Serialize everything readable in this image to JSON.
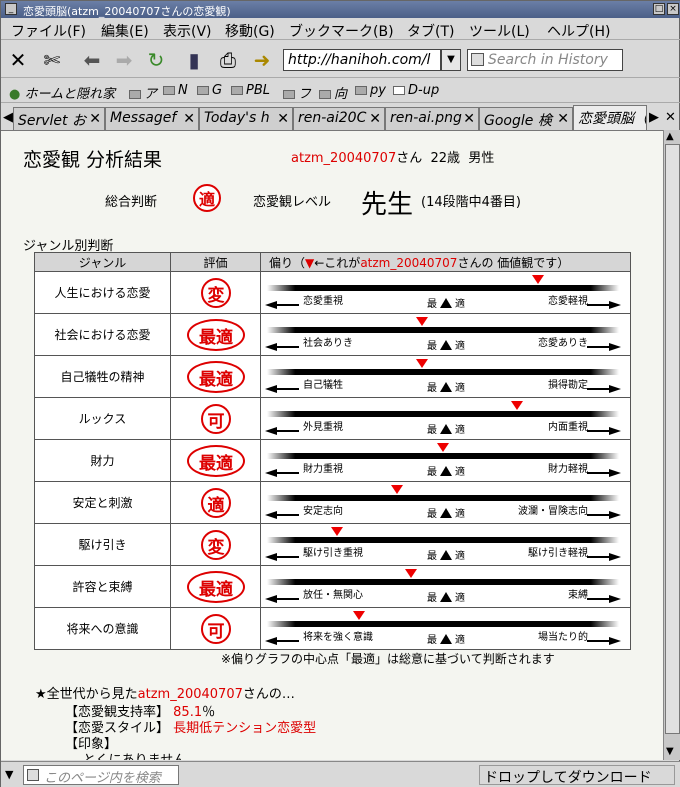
{
  "window": {
    "title": "恋愛頭脳(atzm_20040707さんの恋愛観)"
  },
  "menu": [
    "ファイル(F)",
    "編集(E)",
    "表示(V)",
    "移動(G)",
    "ブックマーク(B)",
    "タブ(T)",
    "ツール(L)",
    "ヘルプ(H)"
  ],
  "toolbar": {
    "url": "http://hanihoh.com/l",
    "search_placeholder": "Search in History"
  },
  "bookmarks": [
    "ホームと隠れ家",
    "ア",
    "N",
    "G",
    "PBL",
    "フ",
    "向",
    "py",
    "D-up"
  ],
  "tabs": [
    "Servlet お",
    "Messagef",
    "Today's h",
    "ren-ai20C",
    "ren-ai.png",
    "Google 検",
    "恋愛頭脳（"
  ],
  "page": {
    "title": "恋愛観 分析結果",
    "user": "atzm_20040707",
    "user_suffix": "さん",
    "age": "22歳",
    "sex": "男性",
    "overall_label": "総合判断",
    "overall_stamp": "適",
    "level_label": "恋愛観レベル",
    "level_value": "先生",
    "level_note": "(14段階中4番目)",
    "genre_heading": "ジャンル別判断",
    "col_genre": "ジャンル",
    "col_eval": "評価",
    "col_bias_a": "偏り（",
    "col_bias_b": "←これが",
    "col_bias_c": "さんの 価値観です）",
    "mid_label": "最",
    "mid_label2": "適",
    "note": "※偏りグラフの中心点「最適」は総意に基づいて判断されます",
    "all_gen": "★全世代から見た",
    "all_gen_suffix": "さんの…",
    "support_label": "【恋愛観支持率】",
    "support_value": "85.1",
    "support_unit": "％",
    "style_label": "【恋愛スタイル】",
    "style_value": "長期低テンション恋愛型",
    "impression_label": "【印象】",
    "impression_value": "とくにありません"
  },
  "rows": [
    {
      "genre": "人生における恋愛",
      "eval": "変",
      "left": "恋愛重視",
      "right": "恋愛軽視",
      "pos": 0.77
    },
    {
      "genre": "社会における恋愛",
      "eval": "最適",
      "left": "社会ありき",
      "right": "恋愛ありき",
      "pos": 0.44
    },
    {
      "genre": "自己犠牲の精神",
      "eval": "最適",
      "left": "自己犠牲",
      "right": "損得勘定",
      "pos": 0.44
    },
    {
      "genre": "ルックス",
      "eval": "可",
      "left": "外見重視",
      "right": "内面重視",
      "pos": 0.71
    },
    {
      "genre": "財力",
      "eval": "最適",
      "left": "財力重視",
      "right": "財力軽視",
      "pos": 0.5
    },
    {
      "genre": "安定と刺激",
      "eval": "適",
      "left": "安定志向",
      "right": "波瀾・冒険志向",
      "pos": 0.37
    },
    {
      "genre": "駆け引き",
      "eval": "変",
      "left": "駆け引き重視",
      "right": "駆け引き軽視",
      "pos": 0.2
    },
    {
      "genre": "許容と束縛",
      "eval": "最適",
      "left": "放任・無関心",
      "right": "束縛",
      "pos": 0.41
    },
    {
      "genre": "将来への意識",
      "eval": "可",
      "left": "将来を強く意識",
      "right": "場当たり的",
      "pos": 0.26
    }
  ],
  "status": {
    "find_placeholder": "このページ内を検索",
    "dropzone": "ドロップしてダウンロード"
  }
}
